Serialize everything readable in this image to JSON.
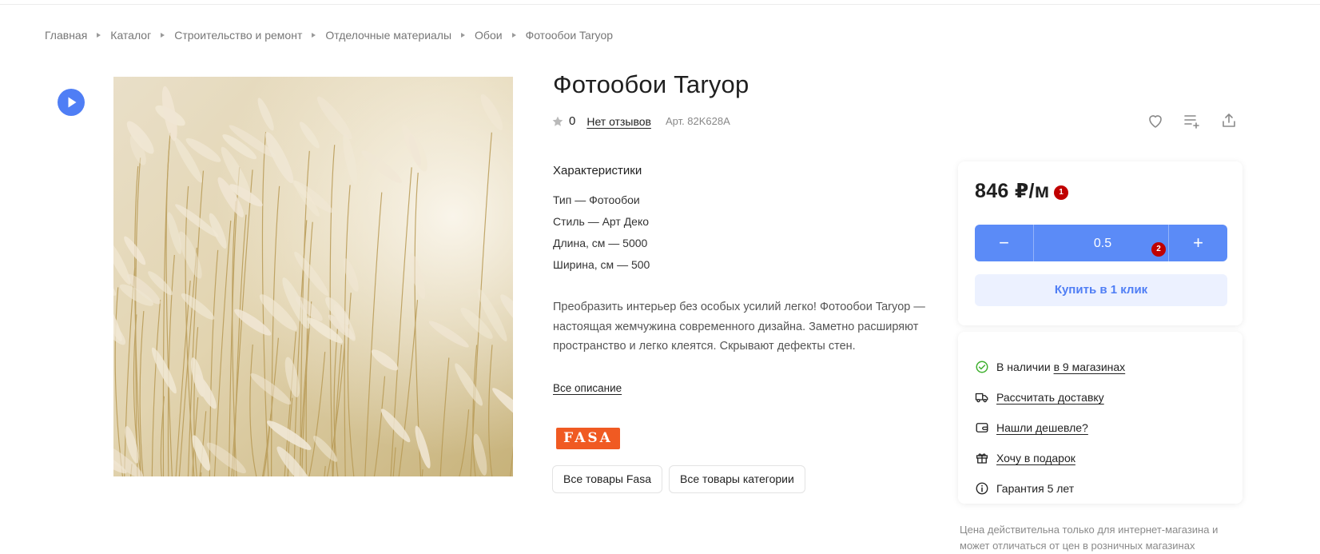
{
  "breadcrumbs": [
    "Главная",
    "Каталог",
    "Строительство и ремонт",
    "Отделочные материалы",
    "Обои",
    "Фотообои Taryop"
  ],
  "product": {
    "title": "Фотообои Taryop",
    "rating_count": "0",
    "reviews_link": "Нет отзывов",
    "sku": "Арт. 82K628A"
  },
  "specs": {
    "heading": "Характеристики",
    "items": [
      "Тип — Фотообои",
      "Стиль — Арт Деко",
      "Длина, см — 5000",
      "Ширина, см — 500"
    ]
  },
  "description": {
    "text": "Преобразить интерьер без особых усилий легко! Фотообои Taryop — настоящая жемчужина современного дизайна. Заметно расширяют пространство и легко клеятся. Скрывают дефекты стен.",
    "link": "Все описание"
  },
  "brand": {
    "logo_text": "FASA"
  },
  "chips": [
    "Все товары Fasa",
    "Все товары категории"
  ],
  "purchase": {
    "price": "846 ₽/м",
    "badge_1": "1",
    "quantity": "0.5",
    "badge_2": "2",
    "minus_label": "−",
    "plus_label": "+",
    "buy_one_click": "Купить в 1 клик"
  },
  "info": {
    "stock_prefix": "В наличии",
    "stock_link": "в 9 магазинах",
    "delivery": "Рассчитать доставку",
    "cheaper": "Нашли дешевле?",
    "gift": "Хочу в подарок",
    "warranty": "Гарантия 5 лет"
  },
  "note": "Цена действительна только для интернет-магазина и может отличаться от цен в розничных магазинах",
  "colors": {
    "accent": "#4f7ef5",
    "stepper": "#5b8bf7",
    "buy_bg": "#ecf1ff",
    "brand": "#f05a22",
    "badge": "#c00000",
    "in_stock": "#3fb02f"
  },
  "icons": [
    "play-icon",
    "star-icon",
    "heart-icon",
    "compare-list-icon",
    "share-icon",
    "check-circle-icon",
    "truck-icon",
    "wallet-icon",
    "gift-icon",
    "info-icon"
  ]
}
